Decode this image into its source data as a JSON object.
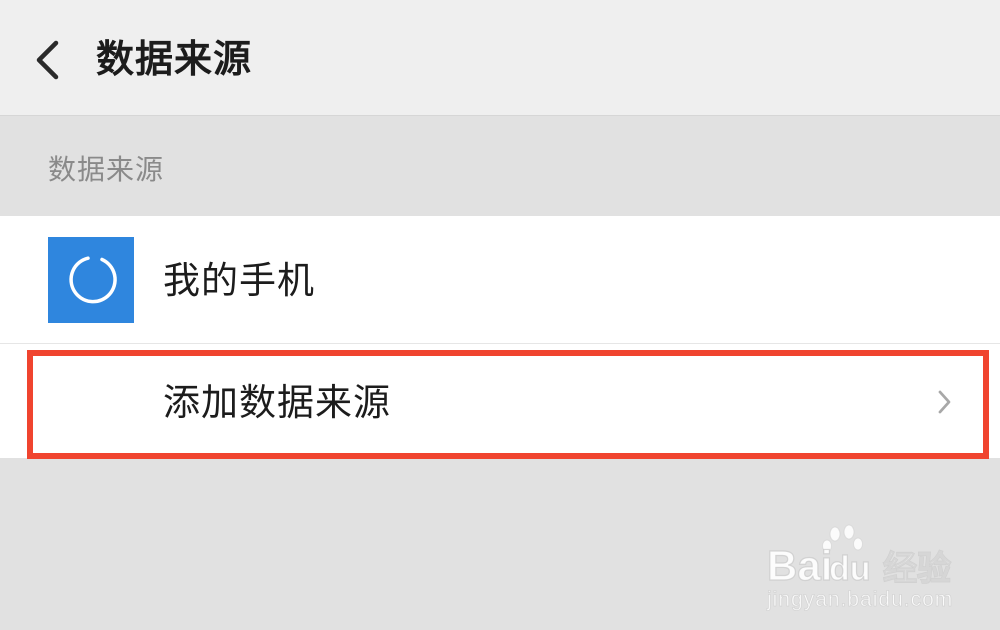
{
  "header": {
    "back_icon": "chevron-left-icon",
    "title": "数据来源"
  },
  "section": {
    "title": "数据来源"
  },
  "list": {
    "items": [
      {
        "label": "我的手机",
        "icon": "circle-icon",
        "icon_bg": "#2f86de"
      },
      {
        "label": "添加数据来源",
        "trailing_icon": "chevron-right-icon"
      }
    ]
  },
  "annotation": {
    "highlight_color": "#f0442f"
  },
  "watermark": {
    "brand_a": "Bai",
    "brand_b": "du",
    "brand_c": "经验",
    "url": "jingyan.baidu.com"
  },
  "colors": {
    "header_bg": "#efefef",
    "page_bg": "#e1e1e1",
    "list_bg": "#ffffff",
    "text_primary": "#1c1c1c",
    "text_secondary": "#8a8a8a"
  }
}
